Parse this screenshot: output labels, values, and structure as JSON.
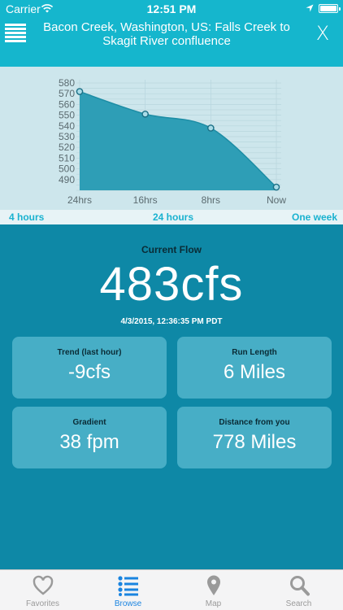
{
  "status_bar": {
    "carrier": "Carrier",
    "time": "12:51 PM"
  },
  "nav": {
    "title": "Bacon Creek, Washington, US: Falls Creek to Skagit River confluence",
    "close_label": "X"
  },
  "chart_data": {
    "type": "area",
    "x": [
      "24hrs",
      "16hrs",
      "8hrs",
      "Now"
    ],
    "values": [
      572,
      551,
      538,
      483
    ],
    "y_ticks": [
      580,
      570,
      560,
      550,
      540,
      530,
      520,
      510,
      500,
      490
    ],
    "ylim": [
      480,
      580
    ],
    "grid": true,
    "colors": {
      "fill": "#2e9eb6",
      "line": "#1d8da5",
      "point": "#a9dce8"
    }
  },
  "range_buttons": [
    {
      "label": "4 hours"
    },
    {
      "label": "24 hours"
    },
    {
      "label": "One week"
    }
  ],
  "current": {
    "label": "Current Flow",
    "value": "483cfs",
    "timestamp": "4/3/2015, 12:36:35 PM PDT"
  },
  "stats": [
    {
      "label": "Trend (last hour)",
      "value": "-9cfs"
    },
    {
      "label": "Run Length",
      "value": "6 Miles"
    },
    {
      "label": "Gradient",
      "value": "38 fpm"
    },
    {
      "label": "Distance from you",
      "value": "778 Miles"
    }
  ],
  "tabs": [
    {
      "label": "Favorites",
      "icon": "heart-icon"
    },
    {
      "label": "Browse",
      "icon": "list-icon"
    },
    {
      "label": "Map",
      "icon": "map-pin-icon"
    },
    {
      "label": "Search",
      "icon": "search-icon"
    }
  ],
  "colors": {
    "header": "#15b6cd",
    "body": "#0e88a6",
    "card": "#47aec6",
    "active_tab": "#1a84e0"
  }
}
